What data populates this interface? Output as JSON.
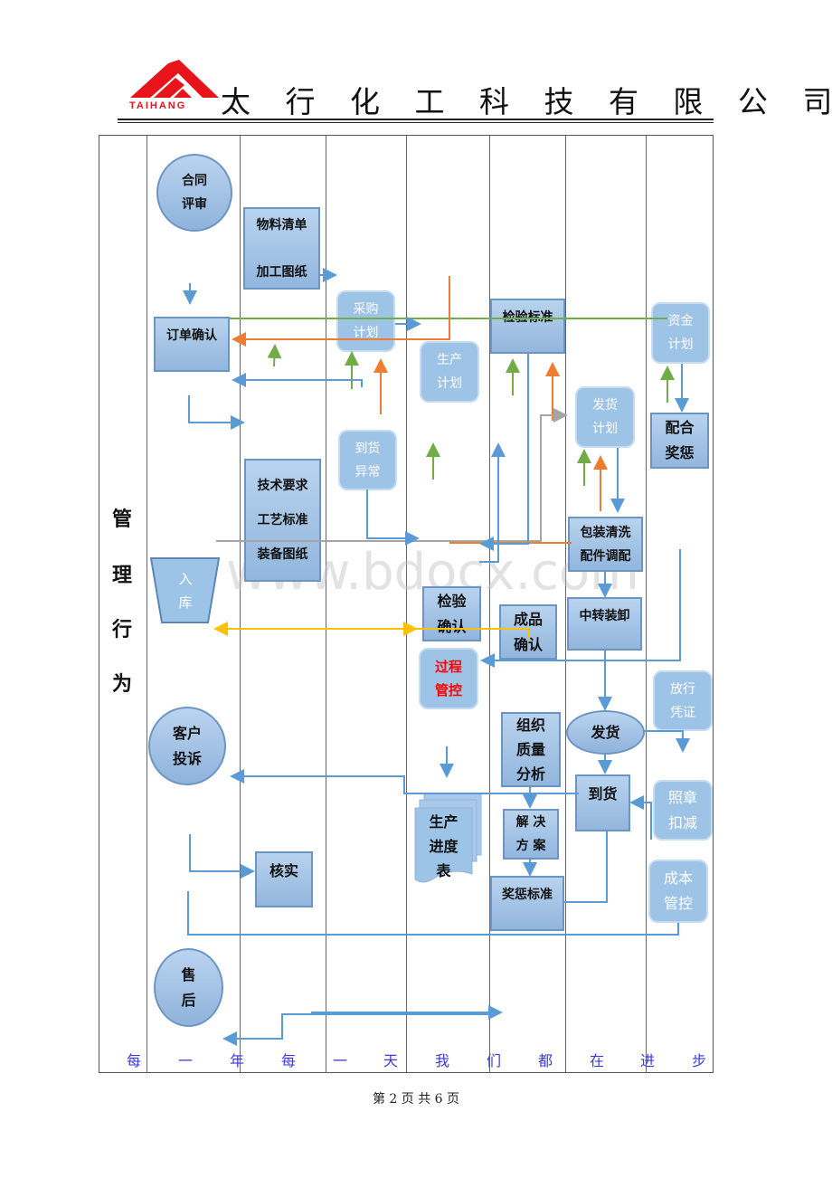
{
  "header": {
    "logo_text": "TAIHANG",
    "company": "太 行 化 工 科 技 有 限 公 司"
  },
  "side_label": [
    "管",
    "理",
    "行",
    "为"
  ],
  "nodes": {
    "contract_review": "合同\n评审",
    "bom": "物料清单\n\n加工图纸",
    "order_confirm": "订单确认",
    "purchase_plan": "采购\n计划",
    "production_plan": "生产\n计划",
    "inspection_std": "检验标准",
    "fund_plan": "资金\n计划",
    "delivery_plan": "发货\n计划",
    "reward_coop": "配合\n奖惩",
    "arrival_abnormal": "到货\n异常",
    "tech_req": "技术要求\n\n工艺标准\n\n装备图纸",
    "packing": "包装清洗\n配件调配",
    "warehouse_in": "入\n库",
    "inspection_confirm": "检验\n确认",
    "product_confirm": "成品\n确认",
    "transfer": "中转装卸",
    "process_control": "过程\n管控",
    "release_voucher": "放行\n凭证",
    "customer_complaint": "客户\n投诉",
    "ship": "发货",
    "quality_analysis": "组织\n质量\n分析",
    "arrival_confirm": "到货",
    "deduction": "照章\n扣减",
    "progress_table": "生产\n进度\n表",
    "solution": "解 决\n方 案",
    "verify": "核实",
    "reward_std": "奖惩标准",
    "cost_control": "成本\n管控",
    "after_sales": "售\n后"
  },
  "motto": [
    "每",
    "一",
    "年",
    "每",
    "一",
    "天",
    "我",
    "们",
    "都",
    "在",
    "进",
    "步"
  ],
  "watermark": "www.bdocx.com",
  "footer": "第 2 页 共 6 页",
  "colors": {
    "blue": "#5b9bd5",
    "orange": "#ed7d31",
    "green": "#70ad47",
    "gray": "#a5a5a5",
    "yellow": "#ffc000",
    "logo_red": "#e8141b"
  }
}
